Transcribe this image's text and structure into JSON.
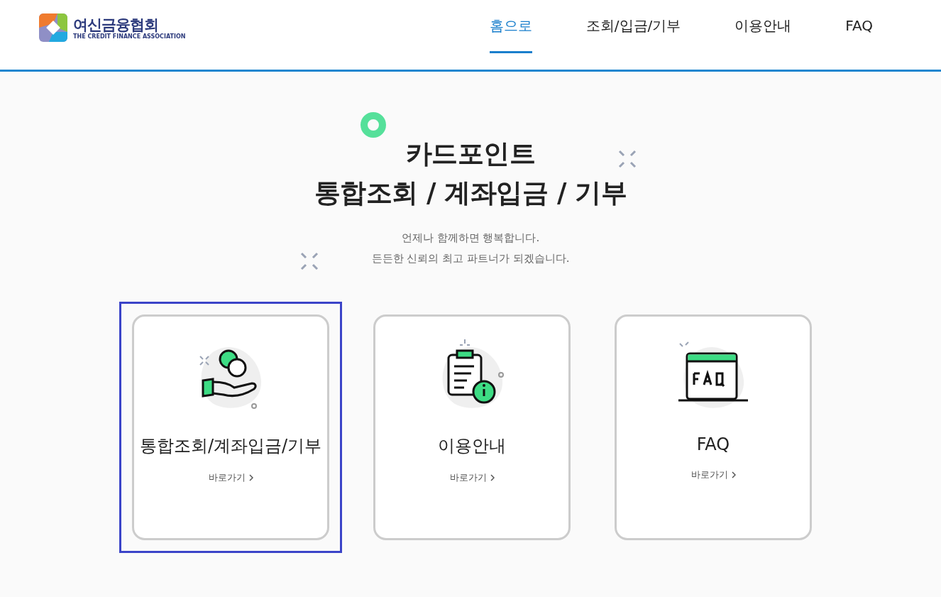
{
  "header": {
    "logo": {
      "name": "여신금융협회",
      "subtitle": "THE CREDIT FINANCE ASSOCIATION"
    },
    "nav": [
      {
        "label": "홈으로",
        "selected": true
      },
      {
        "label": "조회/입금/기부",
        "selected": false
      },
      {
        "label": "이용안내",
        "selected": false
      },
      {
        "label": "FAQ",
        "selected": false
      }
    ]
  },
  "hero": {
    "title_lines": [
      "카드포인트",
      "통합조회 / 계좌입금 / 기부"
    ],
    "subtitle_lines": [
      "언제나 함께하면 행복합니다.",
      "든든한 신뢰의 최고 파트너가 되겠습니다."
    ]
  },
  "cards": [
    {
      "kind": "coins",
      "title": "통합조회/계좌입금/기부",
      "link": "바로가기",
      "focused": true
    },
    {
      "kind": "guide",
      "title": "이용안내",
      "link": "바로가기",
      "focused": false
    },
    {
      "kind": "faq",
      "title": "FAQ",
      "link": "바로가기",
      "focused": false
    }
  ]
}
